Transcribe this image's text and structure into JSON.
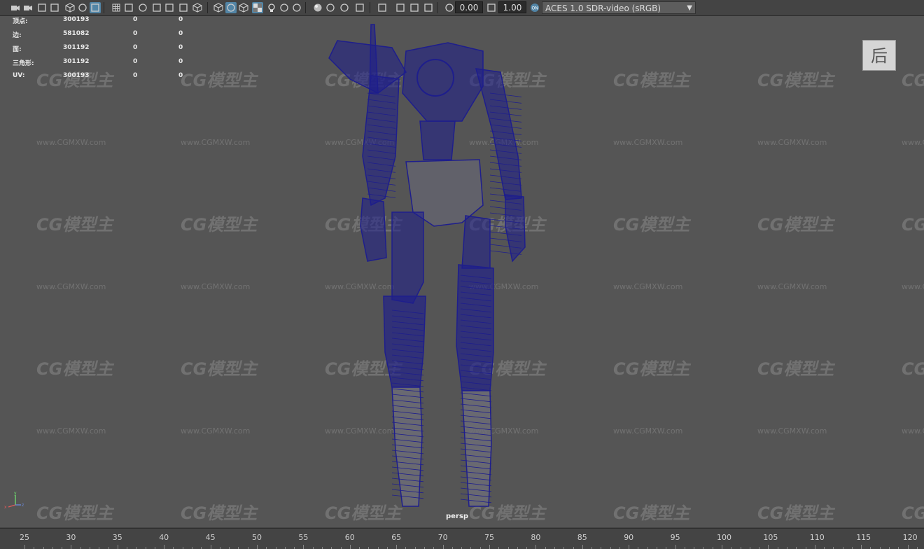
{
  "toolbar": {
    "icons": [
      "camera-select-icon",
      "camera-attributes-icon",
      "image-plane-icon",
      "bookmark-icon",
      "snap-icon",
      "transform-icon",
      "paint-icon",
      "grid-icon",
      "film-gate-icon",
      "resolution-gate-icon",
      "gate-mask-icon",
      "field-chart-icon",
      "safe-title-icon",
      "wireframe-icon",
      "smooth-shade-icon",
      "default-material-icon",
      "textured-icon",
      "checker-icon",
      "lights-icon",
      "shadows-icon",
      "ambient-occlusion-icon",
      "motion-blur-icon",
      "antialias-icon",
      "depth-of-field-icon",
      "isolate-select-icon",
      "xray-icon",
      "xray-active-icon",
      "xray-joints-icon",
      "backface-icon",
      "exposure-icon",
      "gamma-icon"
    ],
    "exposure_value": "0.00",
    "gamma_value": "1.00",
    "color_space": "ACES 1.0 SDR-video (sRGB)"
  },
  "hud": {
    "rows": [
      {
        "label": "顶点:",
        "value": "300193",
        "a": "0",
        "b": "0"
      },
      {
        "label": "边:",
        "value": "581082",
        "a": "0",
        "b": "0"
      },
      {
        "label": "面:",
        "value": "301192",
        "a": "0",
        "b": "0"
      },
      {
        "label": "三角形:",
        "value": "301192",
        "a": "0",
        "b": "0"
      },
      {
        "label": "UV:",
        "value": "300193",
        "a": "0",
        "b": "0"
      }
    ]
  },
  "viewcube_label": "后",
  "camera_label": "persp",
  "axis": {
    "x": "x",
    "y": "y",
    "z": "z"
  },
  "watermark": {
    "logo": "CG模型主",
    "url": "www.CGMXW.com"
  },
  "timeline": {
    "ticks": [
      "25",
      "30",
      "35",
      "40",
      "45",
      "50",
      "55",
      "60",
      "65",
      "70",
      "75",
      "80",
      "85",
      "90",
      "95",
      "100",
      "105",
      "110",
      "115",
      "120"
    ]
  },
  "colors": {
    "wireframe": "#1e1e8c",
    "viewport_bg": "#555555",
    "active_tool": "#5285a6"
  }
}
